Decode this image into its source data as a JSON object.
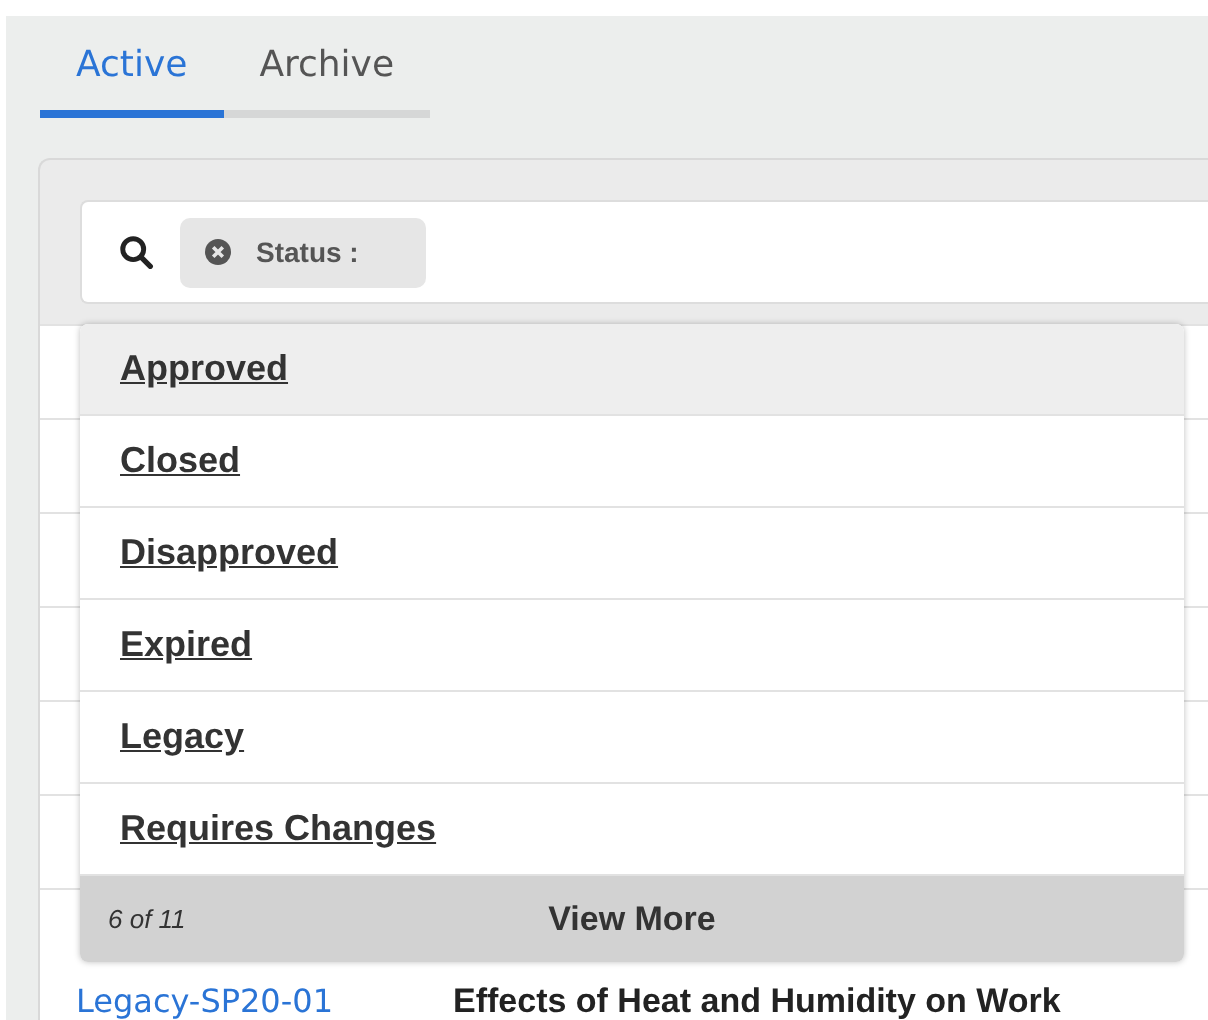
{
  "tabs": [
    {
      "label": "Active",
      "selected": true
    },
    {
      "label": "Archive",
      "selected": false
    }
  ],
  "search": {
    "filter_chip": "Status :"
  },
  "dropdown": {
    "options": [
      {
        "label": "Approved",
        "selected": true
      },
      {
        "label": "Closed",
        "selected": false
      },
      {
        "label": "Disapproved",
        "selected": false
      },
      {
        "label": "Expired",
        "selected": false
      },
      {
        "label": "Legacy",
        "selected": false
      },
      {
        "label": "Requires Changes",
        "selected": false
      }
    ],
    "count": "6 of 11",
    "view_more": "View More"
  },
  "table": {
    "rows": [
      {
        "id": "Legacy-SP20-01",
        "title": "Effects of Heat and Humidity on Work"
      }
    ]
  }
}
